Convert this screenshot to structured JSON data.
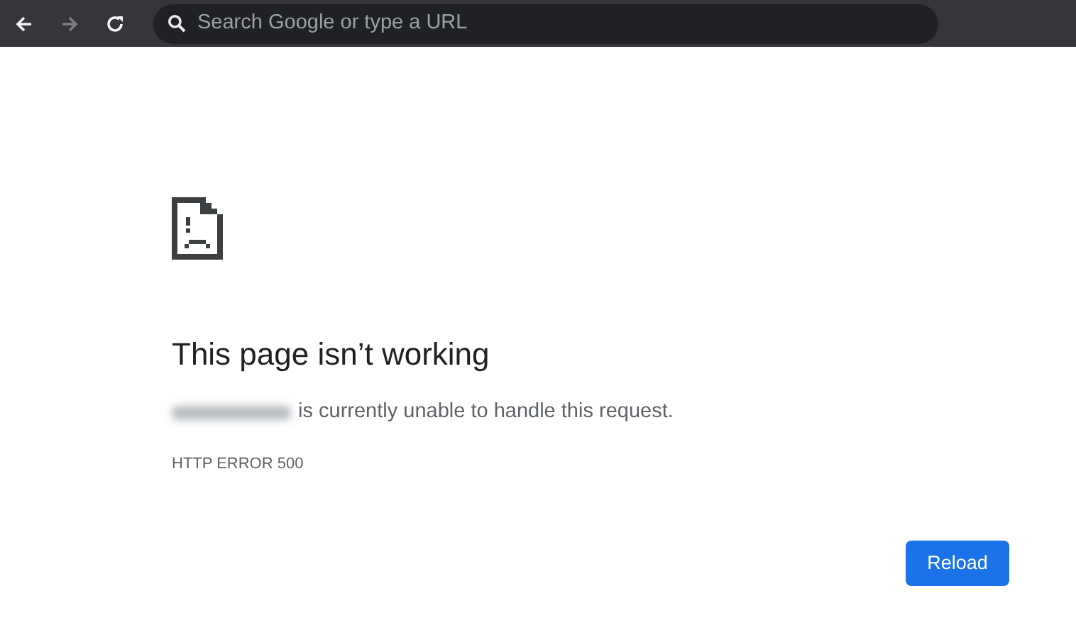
{
  "toolbar": {
    "nav_buttons": [
      {
        "kind": "back",
        "disabled": false
      },
      {
        "kind": "forward",
        "disabled": true
      },
      {
        "kind": "reload",
        "disabled": false
      }
    ],
    "omnibox": {
      "placeholder": "Search Google or type a URL"
    }
  },
  "error_page": {
    "title": "This page isn’t working",
    "message": "is currently unable to handle this request.",
    "error_code": "HTTP ERROR 500",
    "button": "Reload"
  }
}
